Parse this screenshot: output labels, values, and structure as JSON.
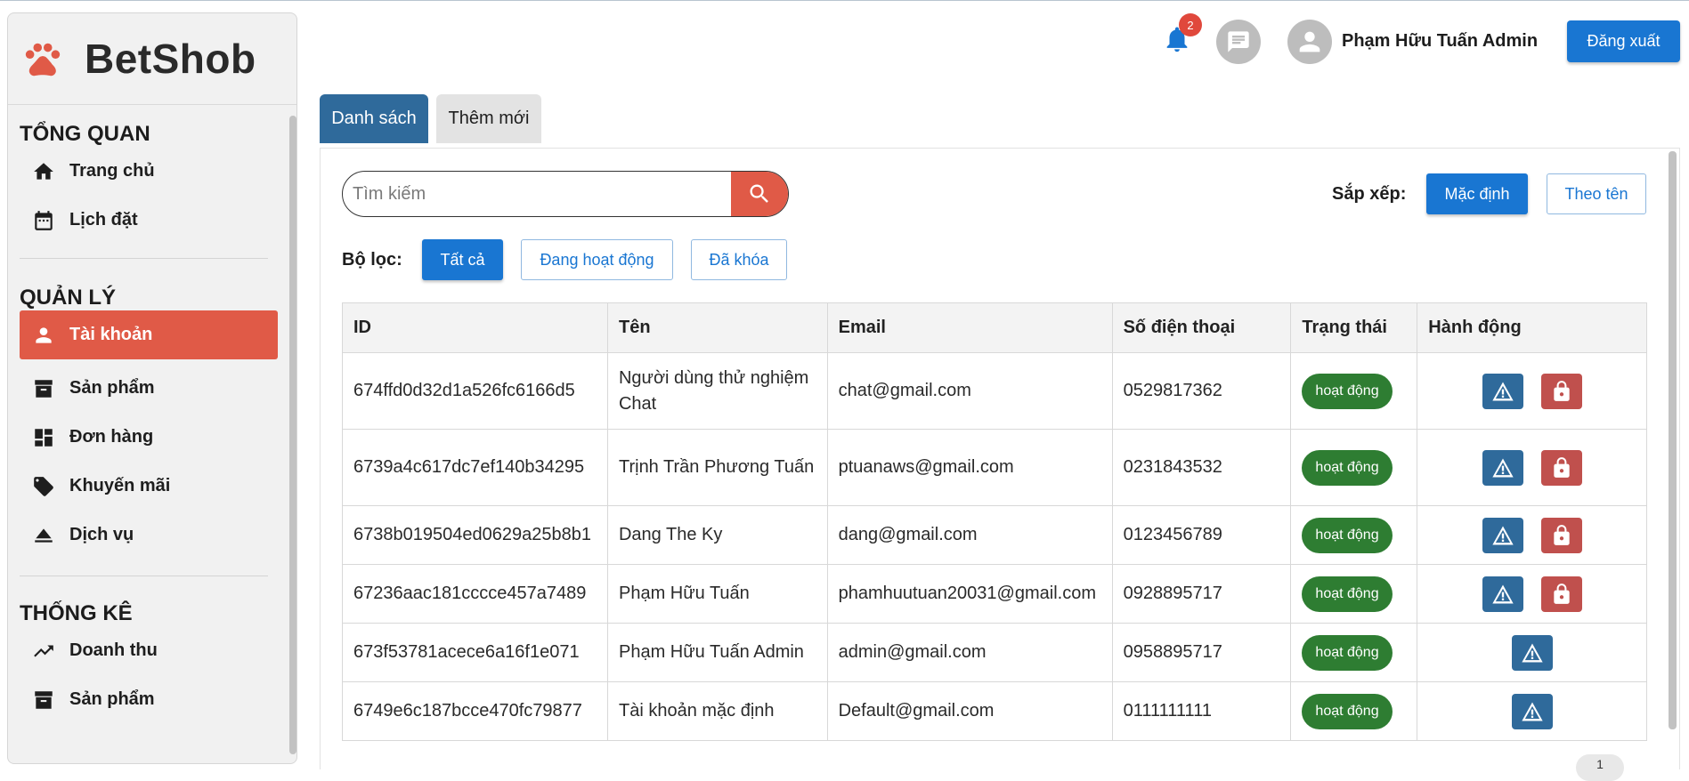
{
  "brand": {
    "name": "BetShob",
    "logo_icon": "paw-icon",
    "logo_color": "#e05a47"
  },
  "sidebar": {
    "sections": [
      {
        "title": "TỔNG QUAN",
        "items": [
          {
            "label": "Trang chủ",
            "icon": "home-icon"
          },
          {
            "label": "Lịch đặt",
            "icon": "calendar-icon"
          }
        ]
      },
      {
        "title": "QUẢN LÝ",
        "items": [
          {
            "label": "Tài khoản",
            "icon": "person-icon",
            "active": true
          },
          {
            "label": "Sản phẩm",
            "icon": "archive-icon"
          },
          {
            "label": "Đơn hàng",
            "icon": "dashboard-icon"
          },
          {
            "label": "Khuyến mãi",
            "icon": "tag-icon"
          },
          {
            "label": "Dịch vụ",
            "icon": "eject-icon"
          }
        ]
      },
      {
        "title": "THỐNG KÊ",
        "items": [
          {
            "label": "Doanh thu",
            "icon": "trending-up-icon"
          },
          {
            "label": "Sản phẩm",
            "icon": "archive-icon"
          }
        ]
      }
    ]
  },
  "header": {
    "notification_count": "2",
    "user_name": "Phạm Hữu Tuấn Admin",
    "logout_label": "Đăng xuất"
  },
  "tabs": [
    {
      "label": "Danh sách",
      "active": true
    },
    {
      "label": "Thêm mới",
      "active": false
    }
  ],
  "search": {
    "placeholder": "Tìm kiếm",
    "value": ""
  },
  "sort": {
    "label": "Sắp xếp:",
    "options": [
      "Mặc định",
      "Theo tên"
    ],
    "selected": "Mặc định"
  },
  "filter": {
    "label": "Bộ lọc:",
    "options": [
      "Tất cả",
      "Đang hoạt động",
      "Đã khóa"
    ],
    "selected": "Tất cả"
  },
  "table": {
    "columns": [
      "ID",
      "Tên",
      "Email",
      "Số điện thoại",
      "Trạng thái",
      "Hành động"
    ],
    "rows": [
      {
        "id": "674ffd0d32d1a526fc6166d5",
        "name": "Người dùng thử nghiệm Chat",
        "email": "chat@gmail.com",
        "phone": "0529817362",
        "status": "hoạt động",
        "lockable": true
      },
      {
        "id": "6739a4c617dc7ef140b34295",
        "name": "Trịnh Trần Phương Tuấn",
        "email": "ptuanaws@gmail.com",
        "phone": "0231843532",
        "status": "hoạt động",
        "lockable": true
      },
      {
        "id": "6738b019504ed0629a25b8b1",
        "name": "Dang The Ky",
        "email": "dang@gmail.com",
        "phone": "0123456789",
        "status": "hoạt động",
        "lockable": true
      },
      {
        "id": "67236aac181cccce457a7489",
        "name": "Phạm Hữu Tuấn",
        "email": "phamhuutuan20031@gmail.com",
        "phone": "0928895717",
        "status": "hoạt động",
        "lockable": true
      },
      {
        "id": "673f53781acece6a16f1e071",
        "name": "Phạm Hữu Tuấn Admin",
        "email": "admin@gmail.com",
        "phone": "0958895717",
        "status": "hoạt động",
        "lockable": false
      },
      {
        "id": "6749e6c187bcce470fc79877",
        "name": "Tài khoản mặc định",
        "email": "Default@gmail.com",
        "phone": "0111111111",
        "status": "hoạt động",
        "lockable": false
      }
    ]
  },
  "pagination": {
    "current_page": "1"
  },
  "colors": {
    "primary": "#1976d2",
    "accent": "#e05a47",
    "tab_active": "#2f6a9b",
    "status_active": "#2e7d32",
    "lock": "#c0504d"
  }
}
